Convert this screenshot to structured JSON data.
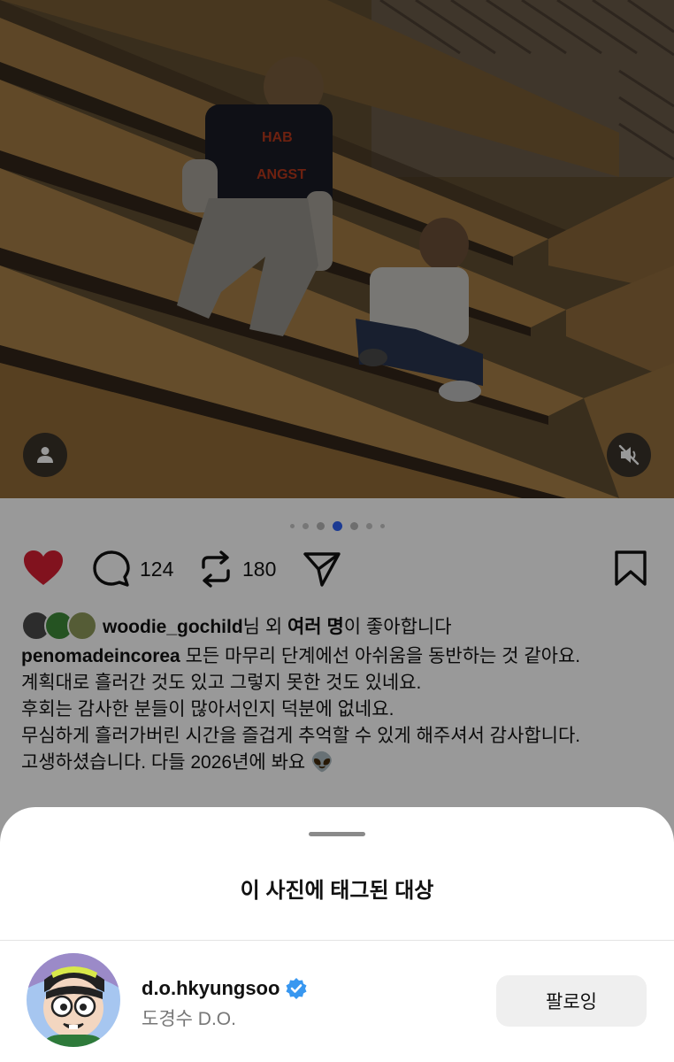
{
  "photo": {
    "shirt_text_line1": "HAB",
    "shirt_text_line2": "ANGST"
  },
  "carousel": {
    "total": 7,
    "active_index": 3
  },
  "actions": {
    "like_icon": "heart-icon",
    "liked": true,
    "like_color": "#d81e32",
    "comment_icon": "comment-icon",
    "comment_count": "124",
    "repost_icon": "repost-icon",
    "repost_count": "180",
    "share_icon": "send-icon",
    "save_icon": "bookmark-icon"
  },
  "likes": {
    "username": "woodie_gochild",
    "suffix": "님 외 ",
    "others": "여러 명",
    "tail": "이 좋아합니다"
  },
  "caption": {
    "author": "penomadeincorea",
    "line1": " 모든 마무리 단계에선 아쉬움을 동반하는 것 같아요.",
    "line2": "계획대로 흘러간 것도 있고 그렇지 못한 것도 있네요.",
    "line3": "후회는 감사한 분들이 많아서인지 덕분에 없네요.",
    "line4": "무심하게 흘러가버린 시간을 즐겁게 추억할 수 있게 해주셔서 감사합니다.",
    "line5": "고생하셨습니다. 다들 2026년에 봐요 ",
    "emoji": "👽"
  },
  "sheet": {
    "title": "이 사진에 태그된 대상",
    "user": {
      "username": "d.o.hkyungsoo",
      "verified": true,
      "full_name": "도경수 D.O.",
      "button_label": "팔로잉"
    }
  },
  "colors": {
    "accent": "#2f63f5",
    "verified": "#3897f0"
  }
}
